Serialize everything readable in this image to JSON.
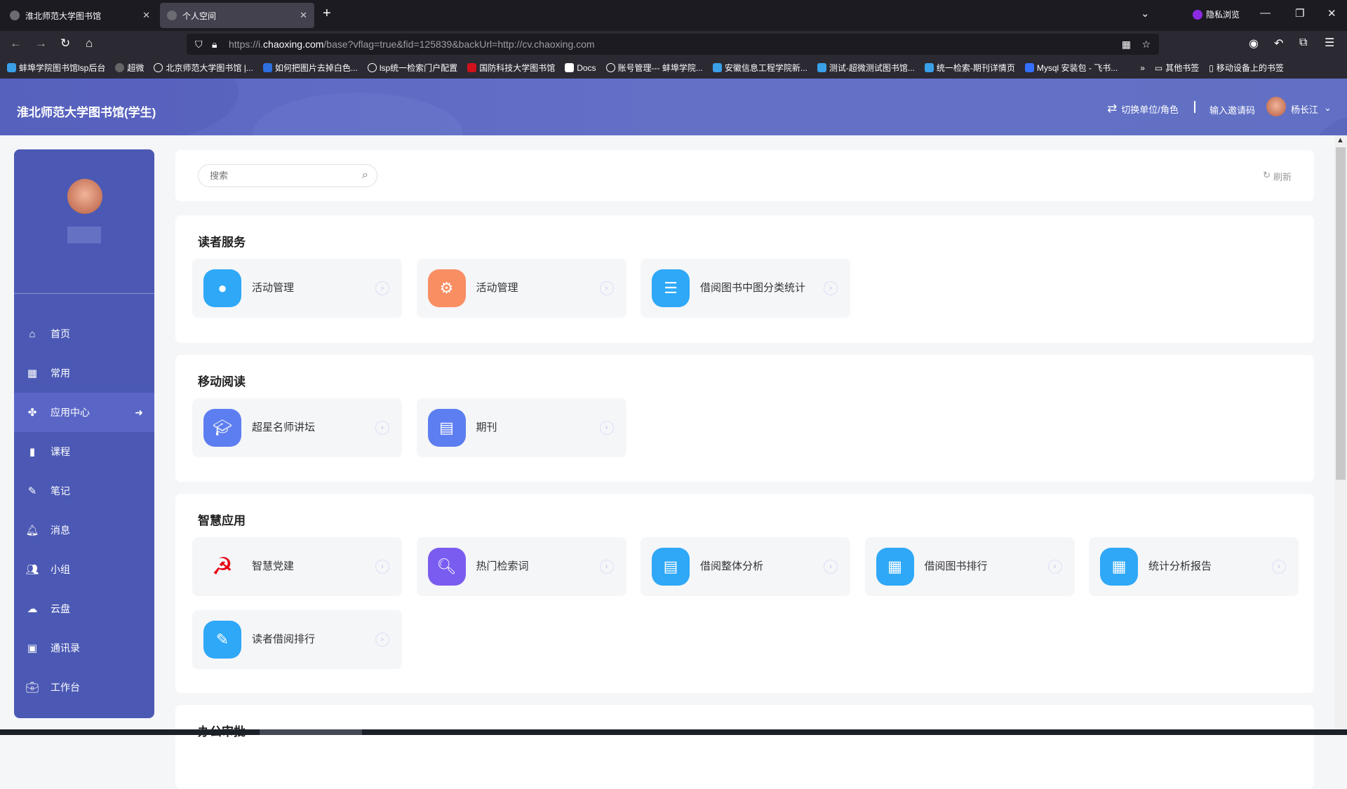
{
  "browser": {
    "tabs": [
      {
        "title": "淮北师范大学图书馆",
        "active": false
      },
      {
        "title": "个人空间",
        "active": true
      }
    ],
    "new_tab": "+",
    "private_label": "隐私浏览",
    "url_prefix": "https://i.",
    "url_domain": "chaoxing.com",
    "url_rest": "/base?vflag=true&fid=125839&backUrl=http://cv.chaoxing.com",
    "bookmarks": [
      "蚌埠学院图书馆lsp后台",
      "超微",
      "北京师范大学图书馆 |...",
      "如何把图片去掉白色...",
      "lsp统一检索门户配置",
      "国防科技大学图书馆",
      "Docs",
      "账号管理--- 蚌埠学院...",
      "安徽信息工程学院新...",
      "测试-超微测试图书馆...",
      "统一检索-期刊详情页",
      "Mysql 安装包 - 飞书..."
    ],
    "more": "»",
    "other_bookmarks": "其他书签",
    "mobile_bookmarks": "移动设备上的书签"
  },
  "header": {
    "title": "淮北师范大学图书馆(学生)",
    "switch_label": "切换单位/角色",
    "invite_label": "输入邀请码",
    "user_name": "杨长江"
  },
  "sidebar": {
    "items": [
      {
        "label": "首页",
        "icon": "home-icon"
      },
      {
        "label": "常用",
        "icon": "grid-icon"
      },
      {
        "label": "应用中心",
        "icon": "apps-icon",
        "active": true
      },
      {
        "label": "课程",
        "icon": "course-icon"
      },
      {
        "label": "笔记",
        "icon": "note-icon"
      },
      {
        "label": "消息",
        "icon": "bell-icon"
      },
      {
        "label": "小组",
        "icon": "group-icon"
      },
      {
        "label": "云盘",
        "icon": "cloud-upload-icon"
      },
      {
        "label": "通讯录",
        "icon": "contacts-icon"
      },
      {
        "label": "工作台",
        "icon": "briefcase-icon"
      }
    ]
  },
  "search": {
    "placeholder": "搜索",
    "refresh": "刷新"
  },
  "sections": [
    {
      "title": "读者服务",
      "cards": [
        {
          "label": "活动管理",
          "color": "#2ea8f7"
        },
        {
          "label": "活动管理",
          "color": "#f98e63"
        },
        {
          "label": "借阅图书中图分类统计",
          "color": "#2ea8f7"
        }
      ]
    },
    {
      "title": "移动阅读",
      "cards": [
        {
          "label": "超星名师讲坛",
          "color": "#5d7ef0"
        },
        {
          "label": "期刊",
          "color": "#5d7ef0"
        }
      ]
    },
    {
      "title": "智慧应用",
      "cards": [
        {
          "label": "智慧党建",
          "color": "#e60012"
        },
        {
          "label": "热门检索词",
          "color": "#7a5cf0"
        },
        {
          "label": "借阅整体分析",
          "color": "#2ea8f7"
        },
        {
          "label": "借阅图书排行",
          "color": "#2ea8f7"
        },
        {
          "label": "统计分析报告",
          "color": "#2ea8f7"
        },
        {
          "label": "读者借阅排行",
          "color": "#2ea8f7"
        }
      ]
    },
    {
      "title": "办公审批",
      "cards": []
    }
  ]
}
